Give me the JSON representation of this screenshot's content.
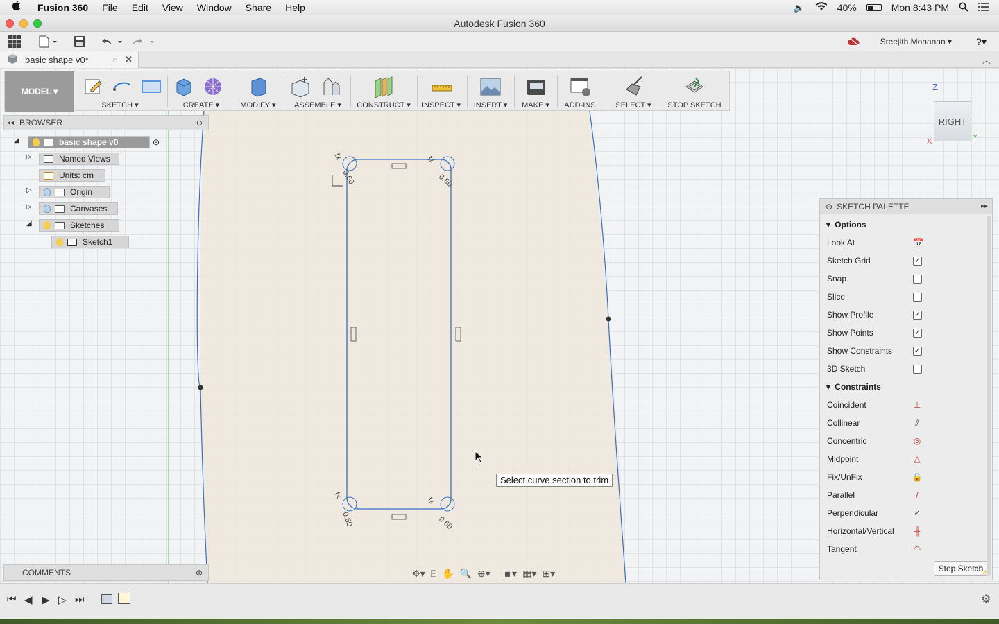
{
  "menubar": {
    "apple": "",
    "items": [
      "Fusion 360",
      "File",
      "Edit",
      "View",
      "Window",
      "Share",
      "Help"
    ],
    "battery": "40%",
    "clock": "Mon 8:43 PM"
  },
  "window": {
    "title": "Autodesk Fusion 360"
  },
  "toolbar": {
    "user": "Sreejith Mohanan ▾",
    "help": "?▾"
  },
  "document_tab": {
    "label": "basic shape v0*"
  },
  "ribbon": {
    "workspace": "MODEL ▾",
    "groups": [
      "SKETCH ▾",
      "CREATE ▾",
      "MODIFY ▾",
      "ASSEMBLE ▾",
      "CONSTRUCT ▾",
      "INSPECT ▾",
      "INSERT ▾",
      "MAKE ▾",
      "ADD-INS",
      "SELECT ▾",
      "STOP SKETCH"
    ]
  },
  "browser": {
    "title": "BROWSER",
    "items": [
      "basic shape v0",
      "Named Views",
      "Units: cm",
      "Origin",
      "Canvases",
      "Sketches",
      "Sketch1"
    ]
  },
  "viewcube": {
    "face": "RIGHT",
    "axis_z": "Z",
    "axis_x": "X",
    "axis_y": "Y"
  },
  "palette": {
    "title": "SKETCH PALETTE",
    "options_title": "Options",
    "options": [
      {
        "label": "Look At",
        "checked": null
      },
      {
        "label": "Sketch Grid",
        "checked": true
      },
      {
        "label": "Snap",
        "checked": false
      },
      {
        "label": "Slice",
        "checked": false
      },
      {
        "label": "Show Profile",
        "checked": true
      },
      {
        "label": "Show Points",
        "checked": true
      },
      {
        "label": "Show Constraints",
        "checked": true
      },
      {
        "label": "3D Sketch",
        "checked": false
      }
    ],
    "constraints_title": "Constraints",
    "constraints": [
      "Coincident",
      "Collinear",
      "Concentric",
      "Midpoint",
      "Fix/UnFix",
      "Parallel",
      "Perpendicular",
      "Horizontal/Vertical",
      "Tangent"
    ],
    "stop_button": "Stop Sketch"
  },
  "comments": {
    "title": "COMMENTS"
  },
  "tooltip": {
    "text": "Select curve section to trim"
  },
  "dimensions": {
    "fillet_radius": "0.60",
    "fixed_label": "fx"
  }
}
